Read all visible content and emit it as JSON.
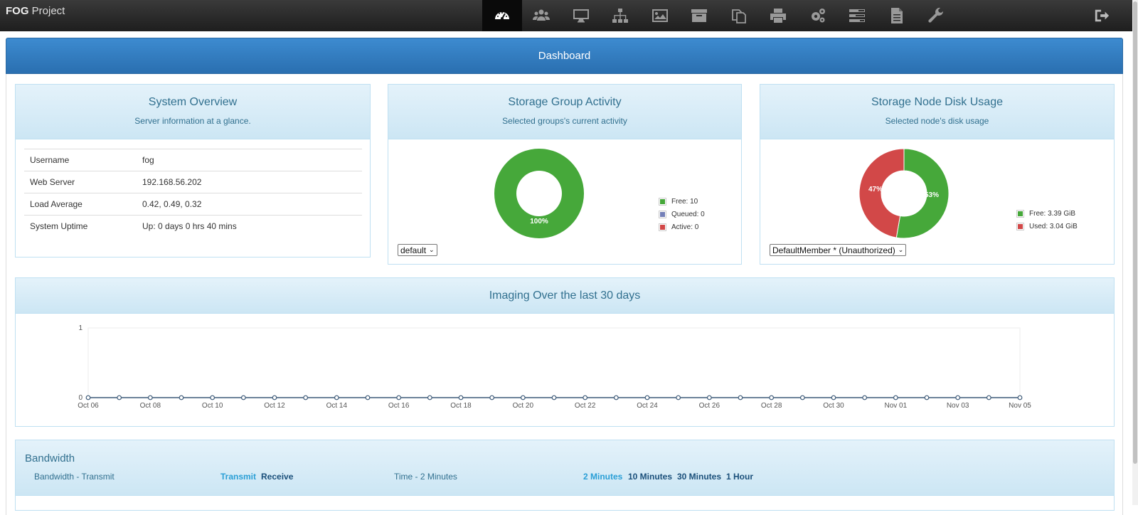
{
  "app": {
    "brand_bold": "FOG",
    "brand_rest": " Project"
  },
  "nav": {
    "icons": [
      "dashboard-icon",
      "users-icon",
      "monitor-icon",
      "sitemap-icon",
      "image-icon",
      "archive-icon",
      "copy-icon",
      "print-icon",
      "cogs-icon",
      "tasks-icon",
      "file-icon",
      "wrench-icon"
    ],
    "active": "dashboard-icon",
    "logout_icon": "sign-out-icon"
  },
  "dashboard": {
    "title": "Dashboard"
  },
  "system_overview": {
    "title": "System Overview",
    "subtitle": "Server information at a glance.",
    "rows": [
      {
        "key": "Username",
        "value": "fog"
      },
      {
        "key": "Web Server",
        "value": "192.168.56.202"
      },
      {
        "key": "Load Average",
        "value": "0.42, 0.49, 0.32"
      },
      {
        "key": "System Uptime",
        "value": "Up: 0 days 0 hrs 40 mins"
      }
    ]
  },
  "storage_group": {
    "title": "Storage Group Activity",
    "subtitle": "Selected groups's current activity",
    "legend": [
      {
        "label": "Free: 10",
        "color": "#46a83a"
      },
      {
        "label": "Queued: 0",
        "color": "#7480b8"
      },
      {
        "label": "Active: 0",
        "color": "#d24848"
      }
    ],
    "donut_label": "100%",
    "slices": [
      {
        "value": 10,
        "color": "#46a83a"
      }
    ],
    "select_value": "default"
  },
  "storage_node": {
    "title": "Storage Node Disk Usage",
    "subtitle": "Selected node's disk usage",
    "legend": [
      {
        "label": "Free: 3.39 GiB",
        "color": "#46a83a"
      },
      {
        "label": "Used: 3.04 GiB",
        "color": "#d24848"
      }
    ],
    "labels": {
      "free": "53%",
      "used": "47%"
    },
    "slices": [
      {
        "value": 3.39,
        "color": "#46a83a"
      },
      {
        "value": 3.04,
        "color": "#d24848"
      }
    ],
    "select_value": "DefaultMember * (Unauthorized)"
  },
  "imaging": {
    "title": "Imaging Over the last 30 days"
  },
  "chart_data": {
    "type": "line",
    "title": "Imaging Over the last 30 days",
    "x": [
      "Oct 06",
      "Oct 07",
      "Oct 08",
      "Oct 09",
      "Oct 10",
      "Oct 11",
      "Oct 12",
      "Oct 13",
      "Oct 14",
      "Oct 15",
      "Oct 16",
      "Oct 17",
      "Oct 18",
      "Oct 19",
      "Oct 20",
      "Oct 21",
      "Oct 22",
      "Oct 23",
      "Oct 24",
      "Oct 25",
      "Oct 26",
      "Oct 27",
      "Oct 28",
      "Oct 29",
      "Oct 30",
      "Oct 31",
      "Nov 01",
      "Nov 02",
      "Nov 03",
      "Nov 04",
      "Nov 05"
    ],
    "xticks": [
      "Oct 06",
      "Oct 08",
      "Oct 10",
      "Oct 12",
      "Oct 14",
      "Oct 16",
      "Oct 18",
      "Oct 20",
      "Oct 22",
      "Oct 24",
      "Oct 26",
      "Oct 28",
      "Oct 30",
      "Nov 01",
      "Nov 03",
      "Nov 05"
    ],
    "series": [
      {
        "values": [
          0,
          0,
          0,
          0,
          0,
          0,
          0,
          0,
          0,
          0,
          0,
          0,
          0,
          0,
          0,
          0,
          0,
          0,
          0,
          0,
          0,
          0,
          0,
          0,
          0,
          0,
          0,
          0,
          0,
          0,
          0
        ],
        "color": "#3d5a78"
      }
    ],
    "ylim": [
      0,
      1
    ],
    "yticks": [
      "0",
      "1"
    ],
    "grid": false
  },
  "bandwidth": {
    "title": "Bandwidth",
    "label": "Bandwidth - Transmit",
    "transmit": "Transmit",
    "receive": "Receive",
    "time_label": "Time - 2 Minutes",
    "times": [
      "2 Minutes",
      "10 Minutes",
      "30 Minutes",
      "1 Hour"
    ]
  }
}
